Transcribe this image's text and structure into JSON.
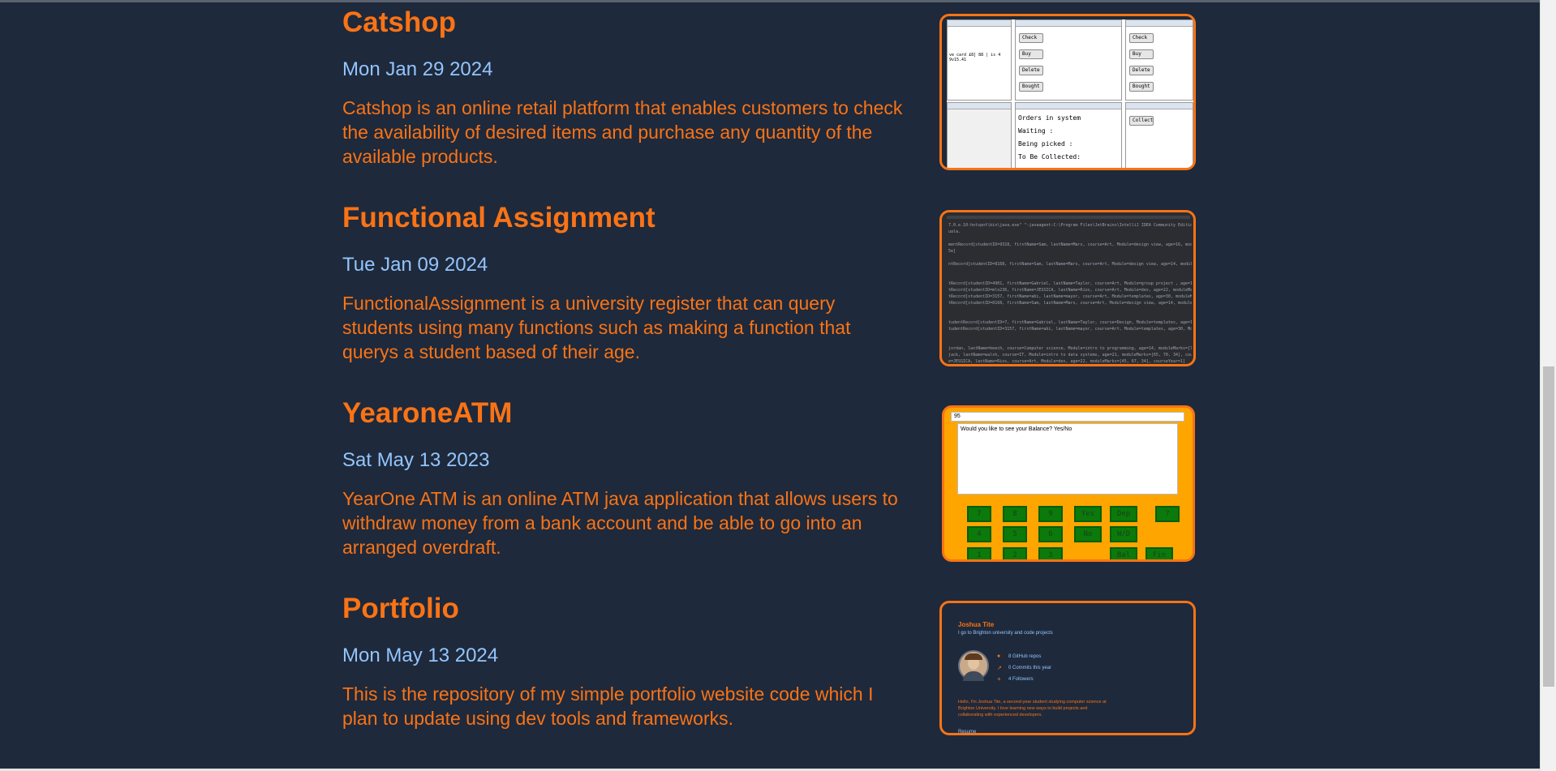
{
  "projects": [
    {
      "title": "Catshop",
      "date": "Mon Jan 29 2024",
      "description": "Catshop is an online retail platform that enables customers to check the availability of desired items and purchase any quantity of the available products.",
      "thumbnail": {
        "buttons": [
          "Check",
          "Buy",
          "Delete",
          "Bought",
          "Check",
          "Buy",
          "Delete",
          "Bought",
          "Collect"
        ],
        "orders_title": "Orders in system",
        "orders_rows": [
          "Waiting     :",
          "Being picked  :",
          "To Be Collected:"
        ]
      }
    },
    {
      "title": "Functional Assignment",
      "date": "Tue Jan 09 2024",
      "description": "FunctionalAssignment is a university register that can query students using many functions such as making a function that querys a student based of their age.",
      "thumbnail": {
        "lines": [
          "7.0.e.10-hotspot\\bin\\java.exe\" \"-javaagent:C:\\Program Files\\JetBrains\\IntelliJ IDEA Community Edition 2",
          "uala.",
          "",
          "mentRecord[studentID=9318, firstName=Sam, lastName=Mars, course=Art, Module=design view, age=16, module",
          "5e]",
          "",
          "ntRecord[studentID=8168, firstName=Sam, lastName=Mars, course=Art, Module=design view, age=14, moduleMa",
          "",
          "",
          "tRecord[studentID=4901, firstName=Gabriel, lastName=Taylor, course=Art, Module=group project , age=15,",
          "tRecord[studentID=mlo236, firstName=JESSICA, lastName=Rios, course=Art, Module=dex, age=22, moduleMark",
          "tRecord[studentID=3157, firstName=abi, lastName=mayor, course=Art, Module=templates, age=30, moduleMark",
          "tRecord[studentID=8168, firstName=Sam, lastName=Mars, course=Art, Module=design view, age=14, moduleMar",
          "",
          "",
          "tudentRecord[studentID=7, firstName=Gabriel, lastName=Taylor, course=Design, Module=templates, age=14,",
          "tudentRecord[studentID=3157, firstName=abi, lastName=mayor, course=Art, Module=templates, age=30, Modul",
          "",
          "",
          "jordan, lastName=beech, course=Computer science, Module=intro to programming, age=14, moduleMarks=[75, 9",
          "jack, lastName=walsh, course=IT, Module=intro to data systems, age=21, moduleMarks=[65, 70, 34], course",
          "e=JESSICA, lastName=Rios, course=Art, Module=dex, age=22, moduleMarks=[45, 67, 34], courseYear=1]"
        ]
      }
    },
    {
      "title": "YearoneATM",
      "date": "Sat May 13 2023",
      "description": "YearOne ATM is an online ATM java application that allows users to withdraw money from a bank account and be able to go into an arranged overdraft.",
      "thumbnail": {
        "number_field": "95",
        "message": "Would you like to see your Balance? Yes/No",
        "keys": [
          "7",
          "8",
          "9",
          "Yes",
          "Dep",
          "?",
          "4",
          "5",
          "6",
          "No",
          "W/D",
          "1",
          "2",
          "3",
          "Bal",
          "Fin"
        ]
      }
    },
    {
      "title": "Portfolio",
      "date": "Mon May 13 2024",
      "description": "This is the repository of my simple portfolio website code which I plan to update using dev tools and frameworks.",
      "thumbnail": {
        "name": "Joshua Tite",
        "subtitle": "I go to Brighton university and code projects",
        "stats": [
          "8 GitHub repos",
          "0 Commits this year",
          "4 Followers"
        ],
        "bio": "Hello, I'm Joshua Tite, a second-year student studying computer science at Brighton University. I love learning new ways to build projects and collaborating with experienced developers.",
        "footer": "Resume"
      }
    }
  ],
  "colors": {
    "background": "#1e293b",
    "accent": "#f97316",
    "date": "#93c5fd"
  }
}
